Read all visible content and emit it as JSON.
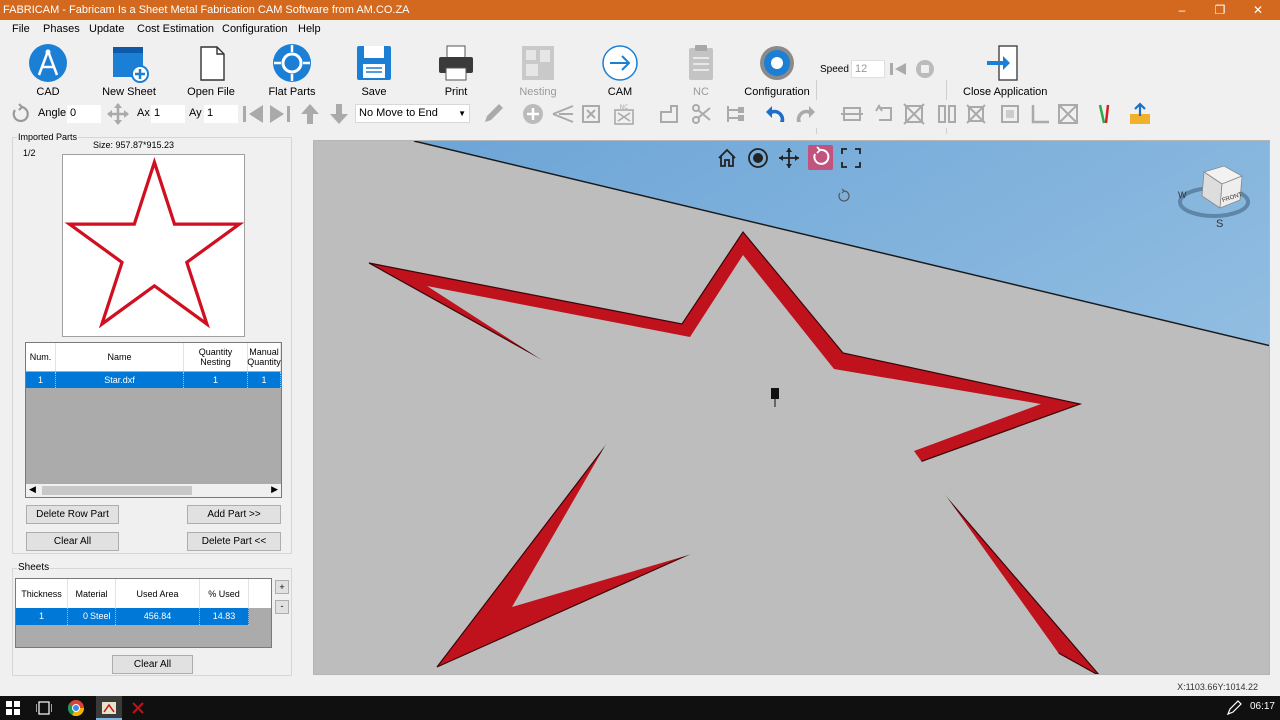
{
  "window": {
    "title": "FABRICAM - Fabricam Is a Sheet Metal Fabrication CAM Software from AM.CO.ZA"
  },
  "menu": [
    "File",
    "Phases",
    "Update",
    "Cost Estimation",
    "Configuration",
    "Help"
  ],
  "toolbar": {
    "cad": "CAD",
    "new_sheet": "New Sheet",
    "open_file": "Open File",
    "flat_parts": "Flat Parts",
    "save": "Save",
    "print": "Print",
    "nesting": "Nesting",
    "cam": "CAM",
    "nc": "NC",
    "configuration": "Configuration",
    "speed_label": "Speed",
    "speed_value": "12",
    "close_application": "Close Application"
  },
  "toolbar2": {
    "angle_label": "Angle",
    "angle_value": "0",
    "ax_label": "Ax",
    "ax_value": "1",
    "ay_label": "Ay",
    "ay_value": "1",
    "move_option": "No Move to End"
  },
  "imported_parts": {
    "title": "Imported Parts",
    "page": "1/2",
    "size": "Size: 957.87*915.23",
    "columns": [
      "Num.",
      "Name",
      "Quantity Nesting",
      "Manual Quantity"
    ],
    "rows": [
      {
        "num": "1",
        "name": "Star.dxf",
        "qty_nesting": "1",
        "manual_qty": "1"
      }
    ],
    "delete_row": "Delete Row Part",
    "add_part": "Add Part >>",
    "clear_all": "Clear All",
    "delete_part": "Delete Part <<"
  },
  "sheets": {
    "title": "Sheets",
    "columns": [
      "Thickness",
      "Material",
      "Used Area",
      "% Used"
    ],
    "rows": [
      {
        "thickness": "1",
        "material_index": "0",
        "material": "Steel",
        "used_area": "456.84",
        "pct_used": "14.83"
      }
    ],
    "plus": "+",
    "minus": "-",
    "clear_all": "Clear All"
  },
  "viewcube": {
    "face": "FRONT",
    "west": "W",
    "south": "S"
  },
  "status": {
    "coords": "X:1103.66Y:1014.22"
  },
  "taskbar": {
    "time": "06:17"
  },
  "colors": {
    "titlebar": "#d2691e",
    "selection": "#0078d7",
    "star": "#c0121c",
    "sky": "#87b7dc"
  }
}
